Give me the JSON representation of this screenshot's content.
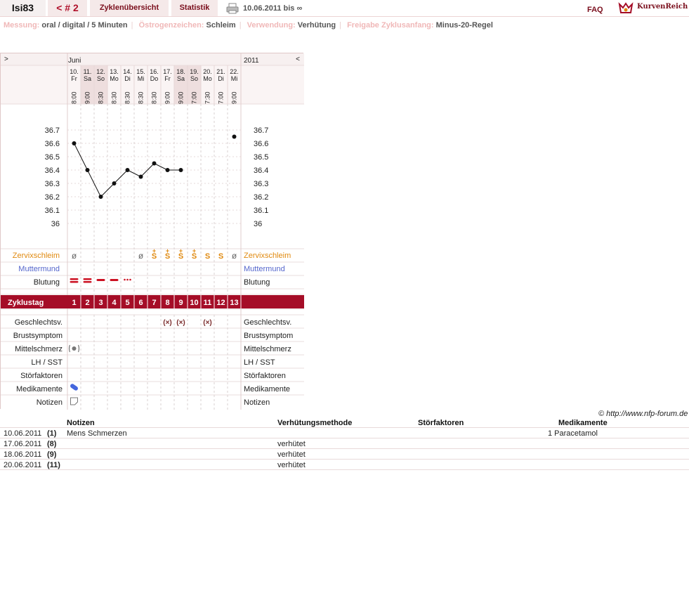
{
  "header": {
    "user": "Isi83",
    "prev_cycle": "< # 2",
    "tab_overview": "Zyklenübersicht",
    "tab_stats": "Statistik",
    "date_range": "10.06.2011 bis ∞",
    "faq": "FAQ",
    "logo": "KurvenReich"
  },
  "settings": [
    {
      "label": "Messung:",
      "value": "oral / digital / 5 Minuten"
    },
    {
      "label": "Östrogenzeichen:",
      "value": "Schleim"
    },
    {
      "label": "Verwendung:",
      "value": "Verhütung"
    },
    {
      "label": "Freigabe Zyklusanfang:",
      "value": "Minus-20-Regel"
    }
  ],
  "chart_nav": {
    "left_arrow": ">",
    "month": "Juni",
    "year": "2011",
    "right_arrow": "<"
  },
  "chart_data": {
    "type": "line",
    "x": [
      "10.",
      "11.",
      "12.",
      "13.",
      "14.",
      "15.",
      "16.",
      "17.",
      "18.",
      "19.",
      "20.",
      "21.",
      "22."
    ],
    "weekdays": [
      "Fr",
      "Sa",
      "So",
      "Mo",
      "Di",
      "Mi",
      "Do",
      "Fr",
      "Sa",
      "So",
      "Mo",
      "Di",
      "Mi"
    ],
    "times": [
      "8:00",
      "9:00",
      "8:30",
      "8:30",
      "8:30",
      "8:30",
      "8:30",
      "9:00",
      "9:00",
      "7:00",
      "7:30",
      "7:00",
      "9:00"
    ],
    "weekend": [
      false,
      true,
      true,
      false,
      false,
      false,
      false,
      false,
      true,
      true,
      false,
      false,
      false
    ],
    "series": [
      {
        "values": [
          36.6,
          36.4,
          36.2,
          36.3,
          36.4,
          36.35,
          36.45,
          36.4,
          36.4,
          null,
          null,
          null,
          36.65
        ]
      }
    ],
    "y_ticks": [
      "36.7",
      "36.6",
      "36.5",
      "36.4",
      "36.3",
      "36.2",
      "36.1",
      "36"
    ],
    "ylim": [
      36.0,
      36.7
    ]
  },
  "rows": {
    "zervix": "Zervixschleim",
    "muttermund": "Muttermund",
    "blutung": "Blutung",
    "zyklustag": "Zyklustag",
    "geschlechtsv": "Geschlechtsv.",
    "brust": "Brustsymptom",
    "mittelschmerz": "Mittelschmerz",
    "lh": "LH / SST",
    "stoer": "Störfaktoren",
    "medi": "Medikamente",
    "notizen": "Notizen"
  },
  "zervix_values": [
    "ø",
    "",
    "",
    "",
    "",
    "ø",
    "S+",
    "S+",
    "S+",
    "S+",
    "S",
    "S",
    "ø"
  ],
  "bleeding": [
    "heavy",
    "heavy",
    "medium",
    "medium",
    "spotting",
    "",
    "",
    "",
    "",
    "",
    "",
    "",
    ""
  ],
  "cycle_days": [
    "1",
    "2",
    "3",
    "4",
    "5",
    "6",
    "7",
    "8",
    "9",
    "10",
    "11",
    "12",
    "13"
  ],
  "intercourse": [
    false,
    false,
    false,
    false,
    false,
    false,
    false,
    true,
    true,
    false,
    true,
    false,
    false
  ],
  "intercourse_symbol": "(×)",
  "colors": {
    "brand": "#a50d27",
    "zervix": "#e08a10",
    "muttermund": "#5566cc",
    "bleed": "#cc1122"
  },
  "credit": "© http://www.nfp-forum.de",
  "notes": {
    "headers": [
      "Notizen",
      "Verhütungsmethode",
      "Störfaktoren",
      "Medikamente"
    ],
    "rows": [
      {
        "date": "10.06.2011",
        "day": "(1)",
        "note": "Mens Schmerzen",
        "method": "",
        "factors": "",
        "meds": "1 Paracetamol"
      },
      {
        "date": "17.06.2011",
        "day": "(8)",
        "note": "",
        "method": "verhütet",
        "factors": "",
        "meds": ""
      },
      {
        "date": "18.06.2011",
        "day": "(9)",
        "note": "",
        "method": "verhütet",
        "factors": "",
        "meds": ""
      },
      {
        "date": "20.06.2011",
        "day": "(11)",
        "note": "",
        "method": "verhütet",
        "factors": "",
        "meds": ""
      }
    ]
  }
}
